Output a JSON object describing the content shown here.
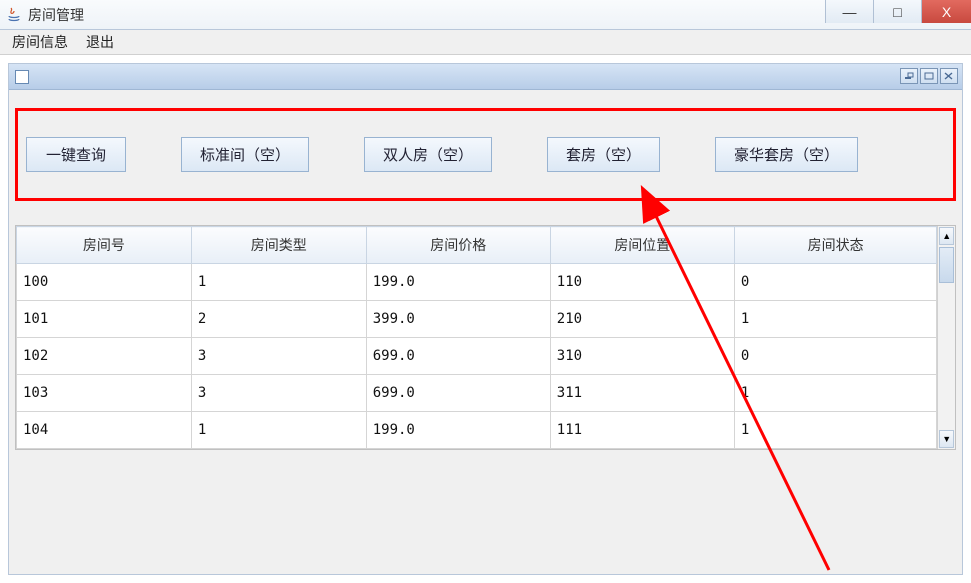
{
  "window": {
    "title": "房间管理",
    "controls": {
      "min": "—",
      "max": "□",
      "close": "X"
    }
  },
  "menubar": {
    "items": [
      {
        "label": "房间信息"
      },
      {
        "label": "退出"
      }
    ]
  },
  "internalFrame": {
    "controls": {
      "iconify": "▫",
      "maximize": "▫",
      "close": "⊠"
    }
  },
  "buttons": {
    "query_all": "一键查询",
    "standard": "标准间（空）",
    "double": "双人房（空）",
    "suite": "套房（空）",
    "deluxe": "豪华套房（空）"
  },
  "table": {
    "headers": [
      "房间号",
      "房间类型",
      "房间价格",
      "房间位置",
      "房间状态"
    ],
    "rows": [
      {
        "c1": "100",
        "c2": "1",
        "c3": "199.0",
        "c4": "110",
        "c5": "0"
      },
      {
        "c1": "101",
        "c2": "2",
        "c3": "399.0",
        "c4": "210",
        "c5": "1"
      },
      {
        "c1": "102",
        "c2": "3",
        "c3": "699.0",
        "c4": "310",
        "c5": "0"
      },
      {
        "c1": "103",
        "c2": "3",
        "c3": "699.0",
        "c4": "311",
        "c5": "1"
      },
      {
        "c1": "104",
        "c2": "1",
        "c3": "199.0",
        "c4": "111",
        "c5": "1"
      }
    ]
  },
  "scroll": {
    "up": "▲",
    "down": "▼"
  }
}
